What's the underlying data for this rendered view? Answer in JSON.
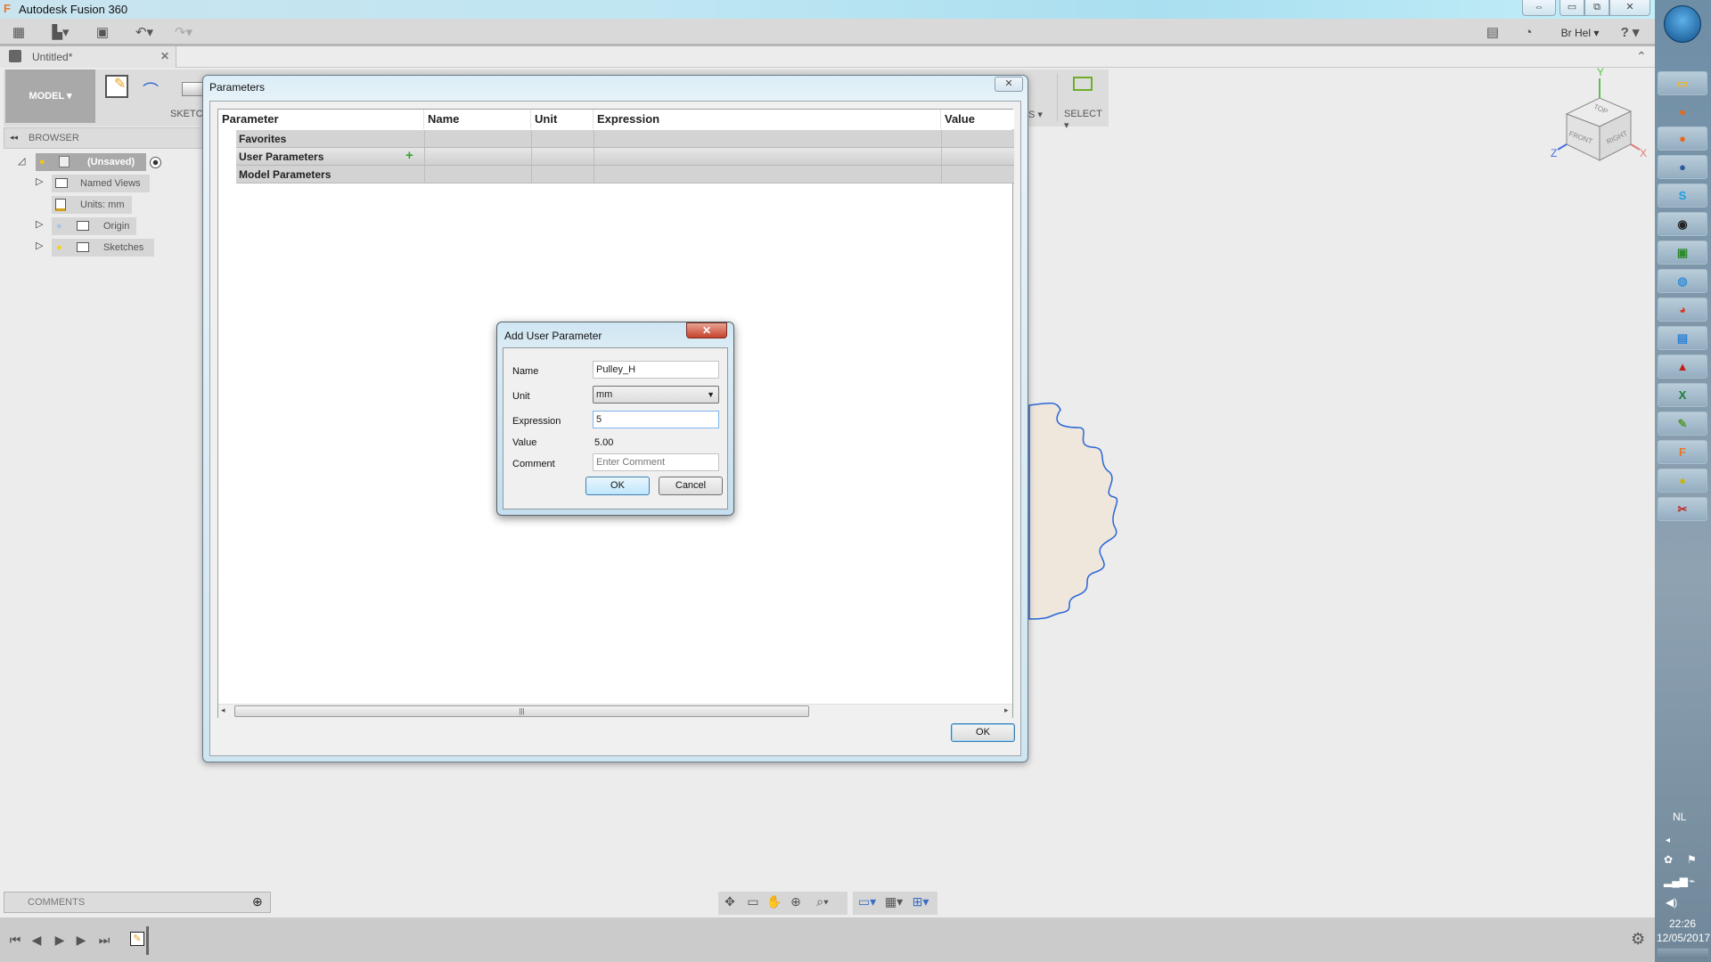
{
  "app": {
    "title": "Autodesk Fusion 360",
    "window_buttons": {
      "restore_size": "⇔",
      "minimize": "▭",
      "maximize": "⧉",
      "close": "✕"
    }
  },
  "quick_toolbar": {
    "user_label": "Br Hel ▾",
    "help_label": "? ▾",
    "icons": [
      "grid-menu-icon",
      "file-icon",
      "save-icon",
      "undo-icon",
      "redo-icon",
      "comment-icon",
      "job-status-icon"
    ]
  },
  "document_tab": {
    "label": "Untitled*",
    "close": "✕"
  },
  "ribbon": {
    "workspace_label": "MODEL ▾",
    "sketch_label": "SKETCH",
    "select_label": "SELECT ▾",
    "partial_label": "S ▾"
  },
  "browser": {
    "header": "BROWSER",
    "collapse_icon": "◂◂",
    "items": [
      {
        "label": "(Unsaved)",
        "level": 0
      },
      {
        "label": "Named Views",
        "level": 1
      },
      {
        "label": "Units: mm",
        "level": 1
      },
      {
        "label": "Origin",
        "level": 1
      },
      {
        "label": "Sketches",
        "level": 1
      }
    ]
  },
  "viewcube": {
    "top": "TOP",
    "front": "FRONT",
    "right": "RIGHT",
    "x": "X",
    "y": "Y",
    "z": "Z"
  },
  "parameters_dialog": {
    "title": "Parameters",
    "columns": [
      "Parameter",
      "Name",
      "Unit",
      "Expression",
      "Value"
    ],
    "groups": [
      "Favorites",
      "User Parameters",
      "Model Parameters"
    ],
    "add_icon": "+",
    "ok_label": "OK"
  },
  "add_user_parameter": {
    "title": "Add User Parameter",
    "close": "✕",
    "name_label": "Name",
    "name_value": "Pulley_H",
    "unit_label": "Unit",
    "unit_value": "mm",
    "expression_label": "Expression",
    "expression_value": "5",
    "value_label": "Value",
    "value_value": "5.00",
    "comment_label": "Comment",
    "comment_placeholder": "Enter Comment",
    "ok_label": "OK",
    "cancel_label": "Cancel"
  },
  "comments": {
    "label": "COMMENTS",
    "add": "⊕"
  },
  "timeline": {
    "controls": [
      "⏮",
      "◀",
      "▶",
      "▶",
      "⏭"
    ]
  },
  "taskbar": {
    "language": "NL",
    "time": "22:26",
    "date": "12/05/2017",
    "apps": [
      "File Explorer",
      "Firefox",
      "Firefox",
      "Thunderbird",
      "Skype",
      "KeePass",
      "Task Manager",
      "Torrent",
      "Chrome",
      "Remote Desktop",
      "Acrobat",
      "Excel",
      "Notepad",
      "Fusion 360",
      "Green Shot",
      "Snipping Tool"
    ]
  }
}
